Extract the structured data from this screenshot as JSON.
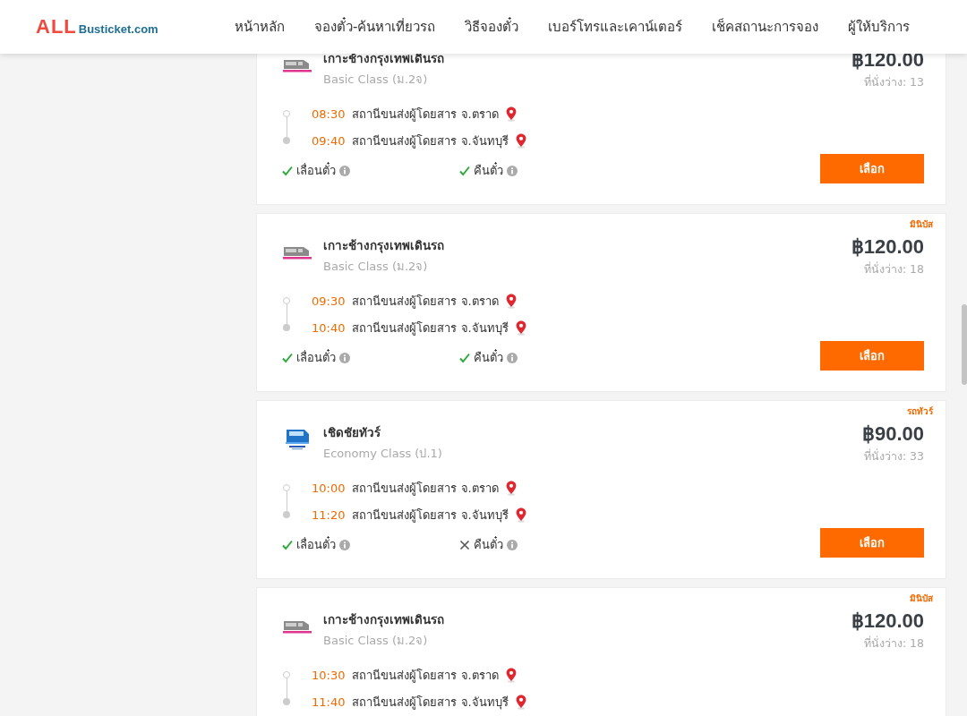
{
  "header": {
    "logo": {
      "brand": "ALL",
      "domain": "Busticket.com"
    },
    "nav": [
      {
        "label": "หน้าหลัก"
      },
      {
        "label": "จองตั๋ว-ค้นหาเที่ยวรถ"
      },
      {
        "label": "วิธีจองตั๋ว"
      },
      {
        "label": "เบอร์โทรและเคาน์เตอร์"
      },
      {
        "label": "เช็คสถานะการจอง"
      },
      {
        "label": "ผู้ให้บริการ"
      }
    ]
  },
  "trips": [
    {
      "operator": "เกาะช้างกรุงเทพเดินรถ",
      "logo": {
        "kind": "minibus"
      },
      "class": "Basic Class (ม.2จ)",
      "price": "฿120.00",
      "seats": "ที่นั่งว่าง: 13",
      "stops": [
        {
          "time": "08:30",
          "station": "สถานีขนส่งผู้โดยสาร จ.ตราด"
        },
        {
          "time": "09:40",
          "station": "สถานีขนส่งผู้โดยสาร จ.จันทบุรี"
        }
      ],
      "features": [
        {
          "label": "เลื่อนตั๋ว",
          "available": true
        },
        {
          "label": "คืนตั๋ว",
          "available": true
        }
      ],
      "button": "เลือก"
    },
    {
      "tag": "มินิบัส",
      "operator": "เกาะช้างกรุงเทพเดินรถ",
      "logo": {
        "kind": "minibus"
      },
      "class": "Basic Class (ม.2จ)",
      "price": "฿120.00",
      "seats": "ที่นั่งว่าง: 18",
      "stops": [
        {
          "time": "09:30",
          "station": "สถานีขนส่งผู้โดยสาร จ.ตราด"
        },
        {
          "time": "10:40",
          "station": "สถานีขนส่งผู้โดยสาร จ.จันทบุรี"
        }
      ],
      "features": [
        {
          "label": "เลื่อนตั๋ว",
          "available": true
        },
        {
          "label": "คืนตั๋ว",
          "available": true
        }
      ],
      "button": "เลือก"
    },
    {
      "tag": "รถทัวร์",
      "operator": "เชิดชัยทัวร์",
      "logo": {
        "kind": "coach"
      },
      "class": "Economy Class (ป.1)",
      "price": "฿90.00",
      "seats": "ที่นั่งว่าง: 33",
      "stops": [
        {
          "time": "10:00",
          "station": "สถานีขนส่งผู้โดยสาร จ.ตราด"
        },
        {
          "time": "11:20",
          "station": "สถานีขนส่งผู้โดยสาร จ.จันทบุรี"
        }
      ],
      "features": [
        {
          "label": "เลื่อนตั๋ว",
          "available": true
        },
        {
          "label": "คืนตั๋ว",
          "available": false
        }
      ],
      "button": "เลือก"
    },
    {
      "tag": "มินิบัส",
      "operator": "เกาะช้างกรุงเทพเดินรถ",
      "logo": {
        "kind": "minibus"
      },
      "class": "Basic Class (ม.2จ)",
      "price": "฿120.00",
      "seats": "ที่นั่งว่าง: 18",
      "stops": [
        {
          "time": "10:30",
          "station": "สถานีขนส่งผู้โดยสาร จ.ตราด"
        },
        {
          "time": "11:40",
          "station": "สถานีขนส่งผู้โดยสาร จ.จันทบุรี"
        }
      ]
    }
  ]
}
